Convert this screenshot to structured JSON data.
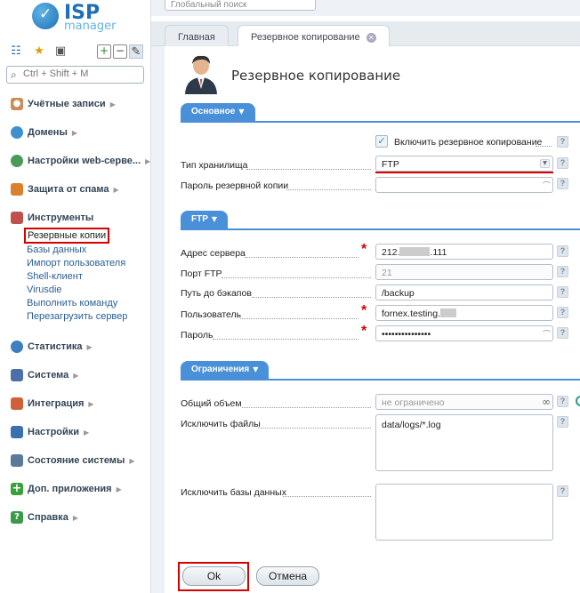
{
  "brand": {
    "isp": "ISP",
    "manager": "manager"
  },
  "sidebar": {
    "search_placeholder": "Ctrl + Shift + M",
    "sections": [
      {
        "label": "Учётные записи"
      },
      {
        "label": "Домены"
      },
      {
        "label": "Настройки web-серве..."
      },
      {
        "label": "Защита от спама"
      },
      {
        "label": "Инструменты"
      },
      {
        "label": "Статистика"
      },
      {
        "label": "Система"
      },
      {
        "label": "Интеграция"
      },
      {
        "label": "Настройки"
      },
      {
        "label": "Состояние системы"
      },
      {
        "label": "Доп. приложения"
      },
      {
        "label": "Справка"
      }
    ],
    "tools_items": [
      "Резервные копии",
      "Базы данных",
      "Импорт пользователя",
      "Shell-клиент",
      "Virusdie",
      "Выполнить команду",
      "Перезагрузить сервер"
    ]
  },
  "topbar": {
    "global_search": "Глобальный поиск"
  },
  "tabs": [
    {
      "label": "Главная"
    },
    {
      "label": "Резервное копирование"
    }
  ],
  "page": {
    "title": "Резервное копирование"
  },
  "sections": {
    "basic": "Основное",
    "ftp": "FTP",
    "limits": "Ограничения"
  },
  "form": {
    "enable_backup_label": "Включить резервное копирование",
    "storage_type_label": "Тип хранилища",
    "storage_type_value": "FTP",
    "backup_password_label": "Пароль резервной копии",
    "backup_password_value": "",
    "server_address_label": "Адрес сервера",
    "server_address_prefix": "212.",
    "server_address_suffix": ".111",
    "ftp_port_label": "Порт FTP",
    "ftp_port_value": "21",
    "backup_path_label": "Путь до бэкапов",
    "backup_path_value": "/backup",
    "user_label": "Пользователь",
    "user_value": "fornex.testing.",
    "password_label": "Пароль",
    "password_value": "•••••••••••••••",
    "total_size_label": "Общий объем",
    "total_size_value": "не ограничено",
    "exclude_files_label": "Исключить файлы",
    "exclude_files_value": "data/logs/*.log",
    "exclude_db_label": "Исключить базы данных",
    "exclude_db_value": ""
  },
  "buttons": {
    "ok": "Ok",
    "cancel": "Отмена"
  },
  "colors": {
    "accent": "#4a90d9",
    "highlight": "#d60000",
    "required": "#d40000"
  }
}
